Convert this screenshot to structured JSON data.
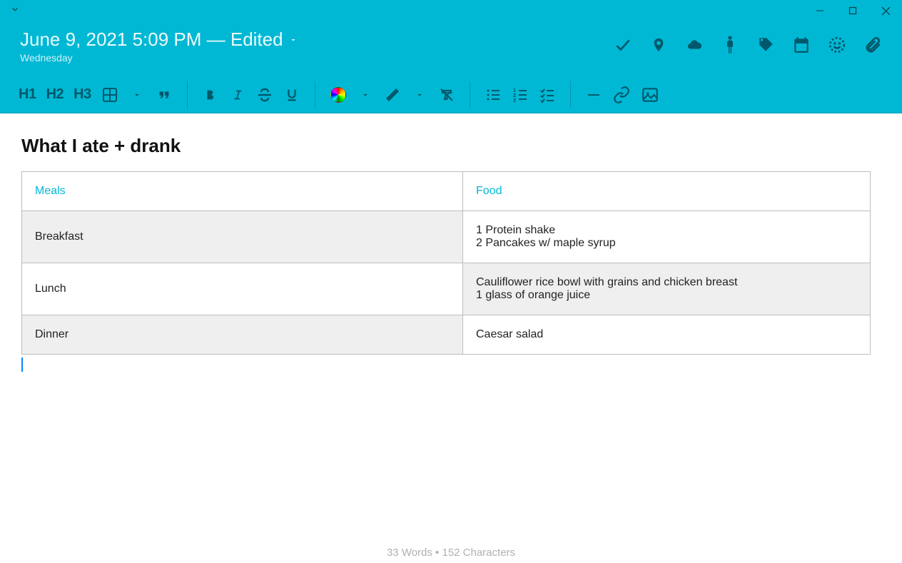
{
  "header": {
    "date": "June 9, 2021 5:09 PM — Edited",
    "weekday": "Wednesday"
  },
  "content": {
    "title": "What I ate + drank",
    "columns": [
      "Meals",
      "Food"
    ],
    "rows": [
      {
        "meal": "Breakfast",
        "food": "1 Protein shake\n2 Pancakes w/ maple syrup"
      },
      {
        "meal": "Lunch",
        "food": "Cauliflower rice bowl with grains and chicken breast\n1 glass of orange juice"
      },
      {
        "meal": "Dinner",
        "food": "Caesar salad"
      }
    ]
  },
  "toolbar": {
    "h1": "H1",
    "h2": "H2",
    "h3": "H3"
  },
  "footer": {
    "text": "33 Words • 152 Characters"
  }
}
